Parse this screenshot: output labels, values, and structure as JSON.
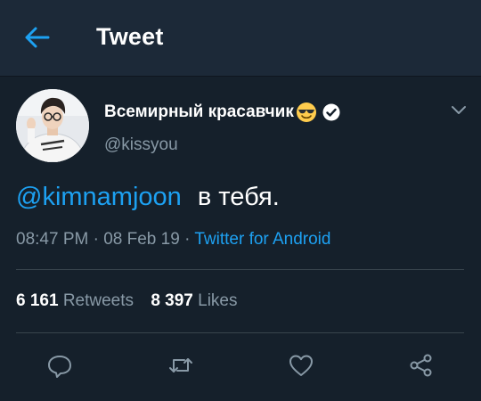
{
  "header": {
    "title": "Tweet",
    "back_icon": "arrow-left-icon"
  },
  "user": {
    "display_name": "Всемирный красавчик",
    "name_emoji": "smiling-face-with-sunglasses-icon",
    "verified_icon": "verified-badge-icon",
    "username": "@kissyou"
  },
  "tweet": {
    "mention": "@kimnamjoon",
    "text": "в тебя.",
    "time": "08:47 PM",
    "date": "08 Feb 19",
    "separator": "·",
    "source": "Twitter for Android"
  },
  "stats": {
    "retweets_count": "6 161",
    "retweets_label": "Retweets",
    "likes_count": "8 397",
    "likes_label": "Likes"
  },
  "actions": [
    "reply-icon",
    "retweet-icon",
    "like-icon",
    "share-icon"
  ],
  "colors": {
    "background": "#15202b",
    "header": "#1c2938",
    "accent": "#1da1f2",
    "secondary_text": "#8899a6",
    "divider": "#38444d"
  }
}
